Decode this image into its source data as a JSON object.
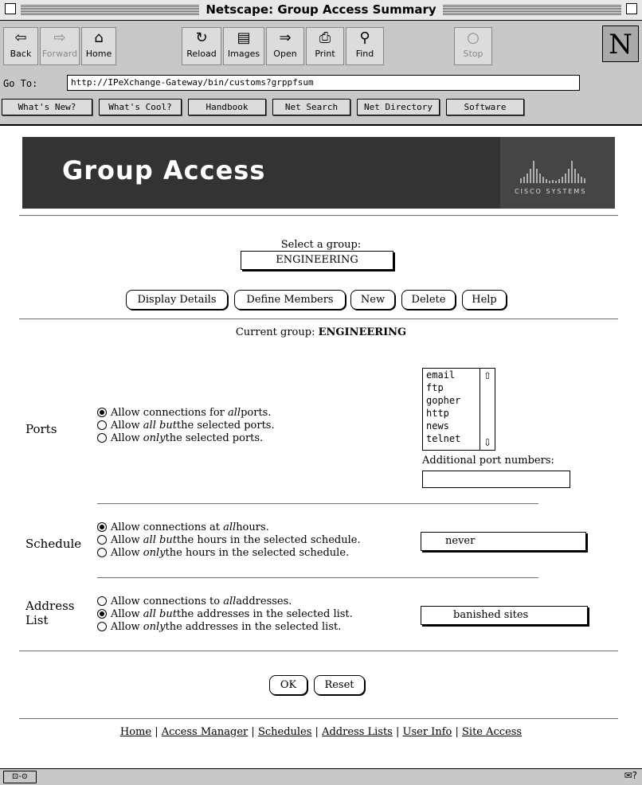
{
  "window": {
    "title": "Netscape: Group Access Summary"
  },
  "toolbar": {
    "buttons": [
      {
        "label": "Back",
        "icon": "⇦"
      },
      {
        "label": "Forward",
        "icon": "⇨"
      },
      {
        "label": "Home",
        "icon": "⌂"
      },
      {
        "label": "Reload",
        "icon": "↻"
      },
      {
        "label": "Images",
        "icon": "▤"
      },
      {
        "label": "Open",
        "icon": "⇒"
      },
      {
        "label": "Print",
        "icon": "⎙"
      },
      {
        "label": "Find",
        "icon": "⚲"
      },
      {
        "label": "Stop",
        "icon": "○"
      }
    ],
    "logo": "N"
  },
  "location": {
    "label": "Go To:",
    "url": "http://IPeXchange-Gateway/bin/customs?grppfsum"
  },
  "directory": [
    "What's New?",
    "What's Cool?",
    "Handbook",
    "Net Search",
    "Net Directory",
    "Software"
  ],
  "banner": {
    "title": "Group Access",
    "logo_text": "CISCO SYSTEMS"
  },
  "group": {
    "select_label": "Select a group:",
    "selected": "ENGINEERING",
    "buttons": [
      "Display Details",
      "Define Members",
      "New",
      "Delete",
      "Help"
    ],
    "current_label": "Current group:",
    "current_value": "ENGINEERING"
  },
  "ports": {
    "label": "Ports",
    "options": [
      {
        "pre": "Allow connections for ",
        "em": "all",
        "post": "ports.",
        "checked": true
      },
      {
        "pre": "Allow ",
        "em": "all but",
        "post": "the selected ports.",
        "checked": false
      },
      {
        "pre": "Allow ",
        "em": "only",
        "post": "the selected ports.",
        "checked": false
      }
    ],
    "list": [
      "email",
      "ftp",
      "gopher",
      "http",
      "news",
      "telnet"
    ],
    "additional_label": "Additional port numbers:",
    "additional_value": ""
  },
  "schedule": {
    "label": "Schedule",
    "options": [
      {
        "pre": "Allow connections at ",
        "em": "all",
        "post": "hours.",
        "checked": true
      },
      {
        "pre": "Allow ",
        "em": "all but",
        "post": "the hours in the selected schedule.",
        "checked": false
      },
      {
        "pre": "Allow ",
        "em": "only",
        "post": "the hours in the selected schedule.",
        "checked": false
      }
    ],
    "selected": "never"
  },
  "address": {
    "label_line1": "Address",
    "label_line2": "List",
    "options": [
      {
        "pre": "Allow connections to ",
        "em": "all",
        "post": "addresses.",
        "checked": false
      },
      {
        "pre": "Allow ",
        "em": "all but",
        "post": "the addresses in the selected list.",
        "checked": true
      },
      {
        "pre": "Allow ",
        "em": "only",
        "post": "the addresses in the selected list.",
        "checked": false
      }
    ],
    "selected": "banished sites"
  },
  "form": {
    "ok": "OK",
    "reset": "Reset"
  },
  "footer": {
    "links": [
      "Home",
      "Access Manager",
      "Schedules",
      "Address Lists",
      "User Info",
      "Site Access"
    ]
  },
  "status": {
    "left": "⊡-⊙",
    "right": "✉?"
  }
}
